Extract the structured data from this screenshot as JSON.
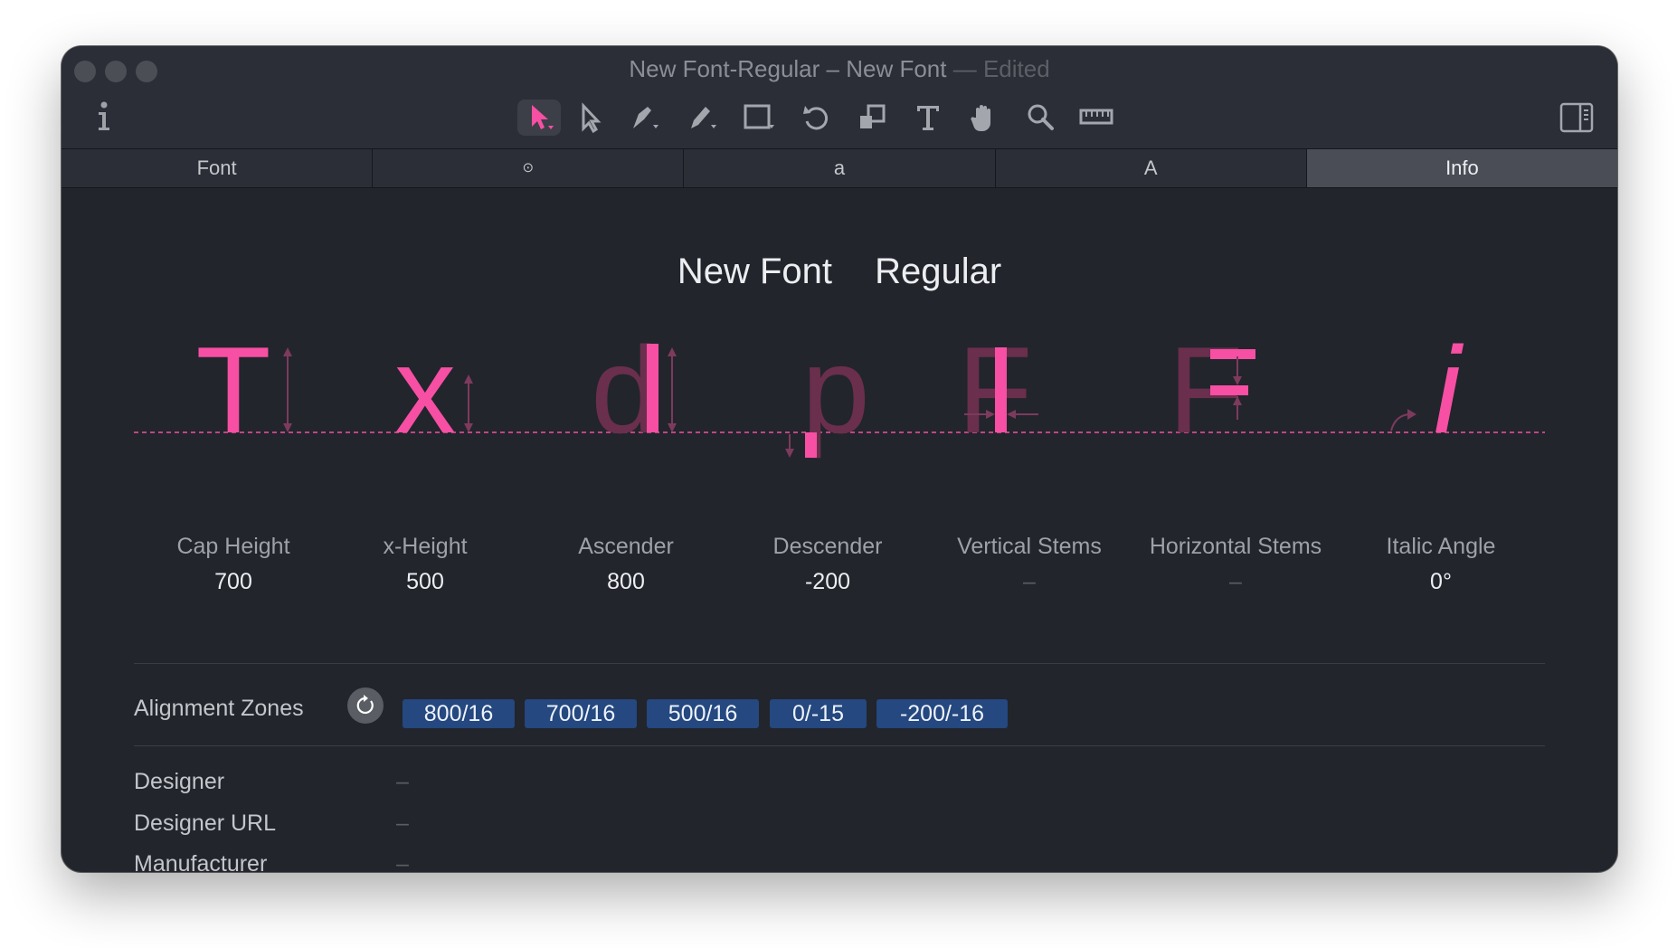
{
  "window": {
    "title_main": "New Font-Regular – New Font",
    "title_sep": "—",
    "title_status": "Edited"
  },
  "toolbar": {
    "icons": [
      "info-icon",
      "select-icon",
      "select-all-icon",
      "pen-icon",
      "pencil-icon",
      "rectangle-icon",
      "rotate-icon",
      "scale-icon",
      "text-icon",
      "hand-icon",
      "zoom-icon",
      "measure-icon",
      "sidebar-icon"
    ]
  },
  "tabs": [
    "Font",
    "⊙",
    "a",
    "A",
    "Info"
  ],
  "selected_tab": "Info",
  "font": {
    "family": "New Font",
    "style": "Regular"
  },
  "glyphs": [
    "T",
    "x",
    "d",
    "p",
    "F",
    "F",
    "i"
  ],
  "metrics": [
    {
      "label": "Cap Height",
      "value": "700"
    },
    {
      "label": "x-Height",
      "value": "500"
    },
    {
      "label": "Ascender",
      "value": "800"
    },
    {
      "label": "Descender",
      "value": "-200"
    },
    {
      "label": "Vertical Stems",
      "value": "–"
    },
    {
      "label": "Horizontal Stems",
      "value": "–"
    },
    {
      "label": "Italic Angle",
      "value": "0°"
    }
  ],
  "alignment_zones": {
    "label": "Alignment Zones",
    "zones": [
      "800/16",
      "700/16",
      "500/16",
      "0/-15",
      "-200/-16"
    ]
  },
  "info_fields": [
    {
      "label": "Designer",
      "value": "–"
    },
    {
      "label": "Designer URL",
      "value": "–"
    },
    {
      "label": "Manufacturer",
      "value": "–"
    }
  ],
  "colors": {
    "accent_pink": "#f74fa3",
    "dim_pink": "#6a2f4d",
    "zone_blue": "#24487f"
  }
}
